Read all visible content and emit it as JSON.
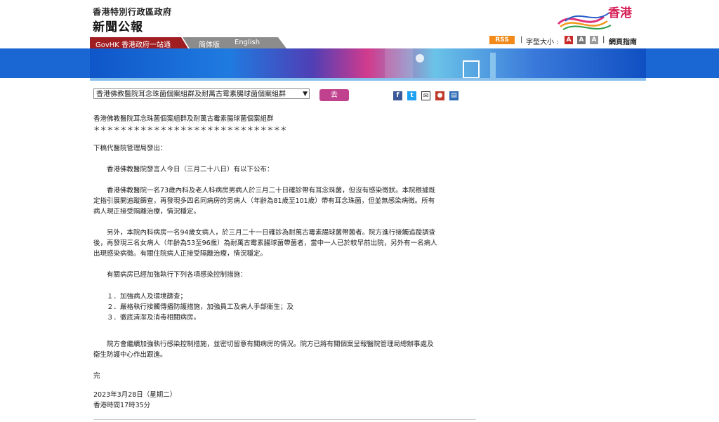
{
  "header": {
    "org": "香港特別行政區政府",
    "title": "新聞公報",
    "logo_text": "香港"
  },
  "nav": {
    "govhk": "GovHK 香港政府一站通",
    "simplified": "简体版",
    "english": "English"
  },
  "tools": {
    "rss": "RSS",
    "font_size_label": "字型大小 :",
    "font_a": "A",
    "guide": "網頁指南"
  },
  "selector": {
    "selected": "香港佛教醫院耳念珠菌個案組群及耐萬古霉素腸球菌個案組群",
    "go": "去"
  },
  "colors": {
    "accent": "#c0418e",
    "nav_red": "#a01d22",
    "rss": "#f28a1a"
  },
  "article": {
    "title": "香港佛教醫院耳念珠菌個案組群及耐萬古霉素腸球菌個案組群",
    "stars": "＊＊＊＊＊＊＊＊＊＊＊＊＊＊＊＊＊＊＊＊＊＊＊＊＊＊＊＊＊",
    "intro": "下稿代醫院管理局發出：",
    "p1": "　　香港佛教醫院發言人今日（三月二十八日）有以下公布：",
    "p2_l1": "　　香港佛教醫院一名73歲內科及老人科病房男病人於三月二十日確診帶有耳念珠菌，但沒有感染徵狀。本院根據既",
    "p2_l2": "定指引展開追蹤篩查，再發現多四名同病房的男病人（年齡為81歲至101歲）帶有耳念珠菌，但並無感染病徵。所有",
    "p2_l3": "病人現正接受隔離治療，情況穩定。",
    "p3_l1": "　　另外，本院內科病房一名94歲女病人，於三月二十一日確診為耐萬古霉素腸球菌帶菌者。院方進行接觸追蹤調查",
    "p3_l2": "後，再發現三名女病人（年齡為53至96歲）為耐萬古霉素腸球菌帶菌者，當中一人已於較早前出院，另外有一名病人",
    "p3_l3": "出現感染病徵。有關住院病人正接受隔離治療，情況穩定。",
    "p4": "　　有關病房已經加強執行下列各項感染控制措施：",
    "m1": "　　１．加強病人及環境篩查；",
    "m2": "　　２．嚴格執行接觸傳播防護措施，加強員工及病人手部衛生；及",
    "m3": "　　３．徹底清潔及消毒相關病房。",
    "p5_l1": "　　院方會繼續加強執行感染控制措施，並密切留意有關病房的情況。院方已將有關個案呈報醫院管理局總辦事處及",
    "p5_l2": "衞生防護中心作出跟進。",
    "end": "完",
    "date": "2023年3月28日（星期二）",
    "time": "香港時間17時35分"
  }
}
